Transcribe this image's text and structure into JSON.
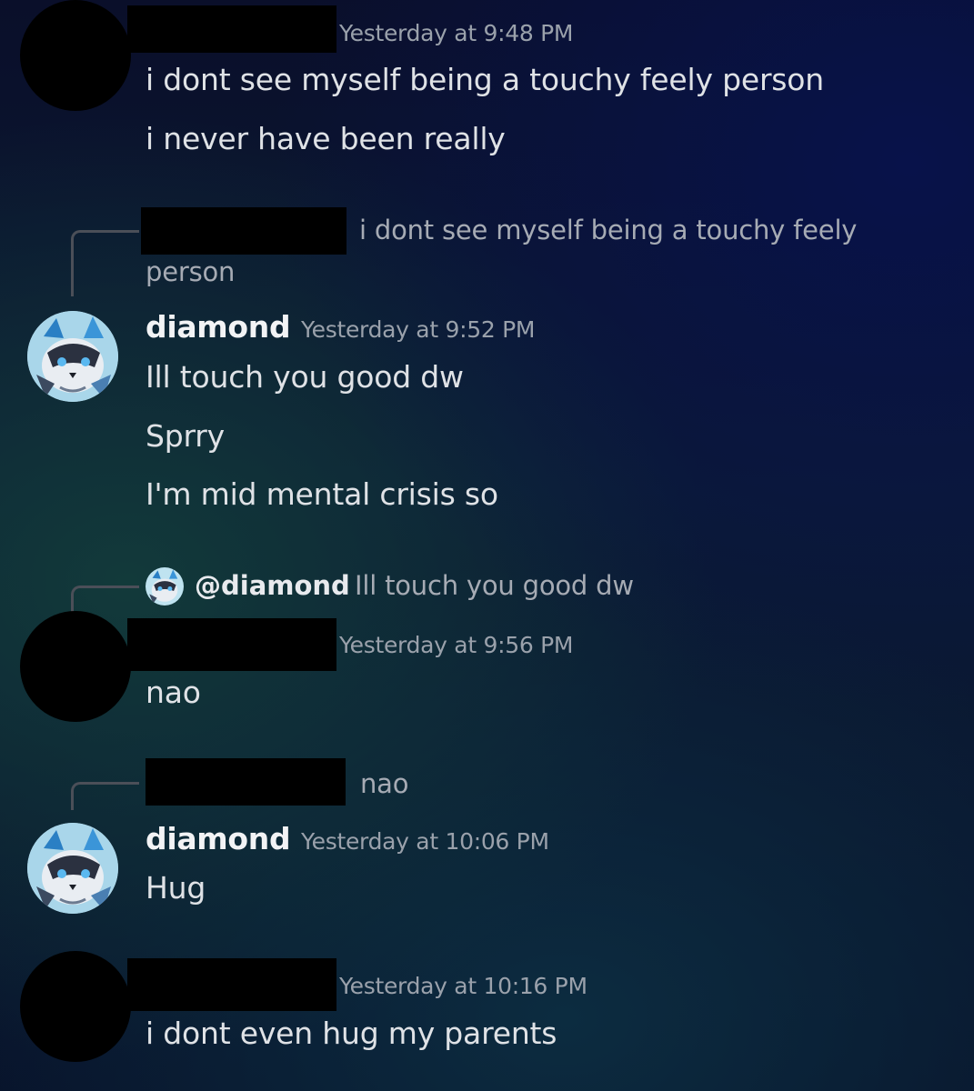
{
  "messages": [
    {
      "timestamp": "Yesterday at 9:48 PM",
      "lines": [
        "i dont see myself being a touchy feely person",
        "i never have been really"
      ]
    },
    {
      "reply_preview_line1": "i dont see myself being a touchy feely",
      "reply_preview_line2": "person",
      "author": "diamond",
      "timestamp": "Yesterday at 9:52 PM",
      "lines": [
        "Ill touch you good dw",
        "Sprry",
        "I'm mid mental crisis so"
      ]
    },
    {
      "reply_mention": "@diamond",
      "reply_preview": "Ill touch you good dw",
      "timestamp": "Yesterday at 9:56 PM",
      "lines": [
        "nao"
      ]
    },
    {
      "reply_preview": "nao",
      "author": "diamond",
      "timestamp": "Yesterday at 10:06 PM",
      "lines": [
        "Hug"
      ]
    },
    {
      "timestamp": "Yesterday at 10:16 PM",
      "lines": [
        "i dont even hug my parents"
      ]
    }
  ]
}
